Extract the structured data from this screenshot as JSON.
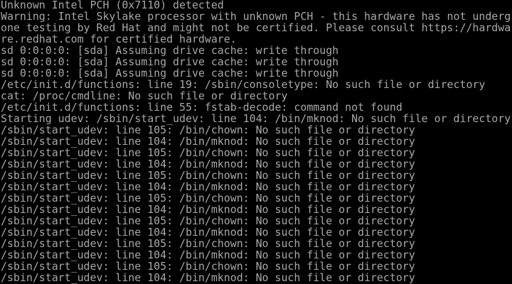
{
  "screen": {
    "background": "#000000",
    "text_color": "#a8a8a8",
    "lines": [
      "Unknown Intel PCH (0x7110) detected",
      "Warning: Intel Skylake processor with unknown PCH - this hardware has not underg",
      "one testing by Red Hat and might not be certified. Please consult https://hardwa",
      "re.redhat.com for certified hardware.",
      "sd 0:0:0:0: [sda] Assuming drive cache: write through",
      "sd 0:0:0:0: [sda] Assuming drive cache: write through",
      "sd 0:0:0:0: [sda] Assuming drive cache: write through",
      "/etc/init.d/functions: line 19: /sbin/consoletype: No such file or directory",
      "cat: /proc/cmdline: No such file or directory",
      "/etc/init.d/functions: line 55: fstab-decode: command not found",
      "Starting udev: /sbin/start_udev: line 104: /bin/mknod: No such file or directory",
      "/sbin/start_udev: line 105: /bin/chown: No such file or directory",
      "/sbin/start_udev: line 104: /bin/mknod: No such file or directory",
      "/sbin/start_udev: line 105: /bin/chown: No such file or directory",
      "/sbin/start_udev: line 104: /bin/mknod: No such file or directory",
      "/sbin/start_udev: line 105: /bin/chown: No such file or directory",
      "/sbin/start_udev: line 104: /bin/mknod: No such file or directory",
      "/sbin/start_udev: line 105: /bin/chown: No such file or directory",
      "/sbin/start_udev: line 104: /bin/mknod: No such file or directory",
      "/sbin/start_udev: line 105: /bin/chown: No such file or directory",
      "/sbin/start_udev: line 104: /bin/mknod: No such file or directory",
      "/sbin/start_udev: line 105: /bin/chown: No such file or directory",
      "/sbin/start_udev: line 104: /bin/mknod: No such file or directory",
      "/sbin/start_udev: line 105: /bin/chown: No such file or directory",
      "/sbin/start_udev: line 104: /bin/mknod: No such file or directory"
    ]
  }
}
